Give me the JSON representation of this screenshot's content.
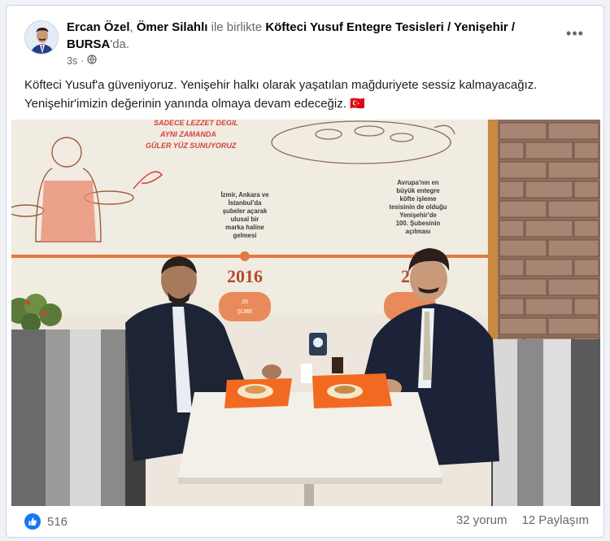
{
  "post": {
    "author": "Ercan Özel",
    "separator": ",",
    "coauthor": "Ömer Silahlı",
    "with_text": "ile birlikte",
    "location_part1": "Köfteci Yusuf Entegre Tesisleri / Yenişehir /",
    "location_part2": "BURSA",
    "location_suffix": "'da.",
    "time": "3s",
    "privacy_icon": "globe-icon",
    "text": "Köfteci Yusuf'a güveniyoruz. Yenişehir halkı olarak yaşatılan mağduriyete sessiz kalmayacağız. Yenişehir'imizin değerinin yanında olmaya devam edeceğiz.",
    "flag": "🇹🇷",
    "more_icon": "•••"
  },
  "photo": {
    "wall_text_top_line1": "SADECE LEZZET DEĞİL",
    "wall_text_top_line2": "AYNI ZAMANDA",
    "wall_text_top_line3": "GÜLER YÜZ SUNUYORUZ",
    "milestone1_line1": "İzmir, Ankara ve",
    "milestone1_line2": "İstanbul'da",
    "milestone1_line3": "şubeler açarak",
    "milestone1_line4": "ulusal bir",
    "milestone1_line5": "marka haline",
    "milestone1_line6": "gelmesi",
    "milestone2_line1": "Avrupa'nın en",
    "milestone2_line2": "büyük entegre",
    "milestone2_line3": "köfte işleme",
    "milestone2_line4": "tesisinin de olduğu",
    "milestone2_line5": "Yenişehir'de",
    "milestone2_line6": "100. Şubesinin",
    "milestone2_line7": "açılması",
    "year1": "2016",
    "year1_badge_line1": "28",
    "year1_badge_line2": "ŞUBE",
    "year2": "20"
  },
  "footer": {
    "like_count": "516",
    "comments": "32 yorum",
    "shares": "12 Paylaşım"
  },
  "colors": {
    "accent": "#1877f2",
    "wall_line": "#e07a44",
    "tray": "#f26a21"
  }
}
